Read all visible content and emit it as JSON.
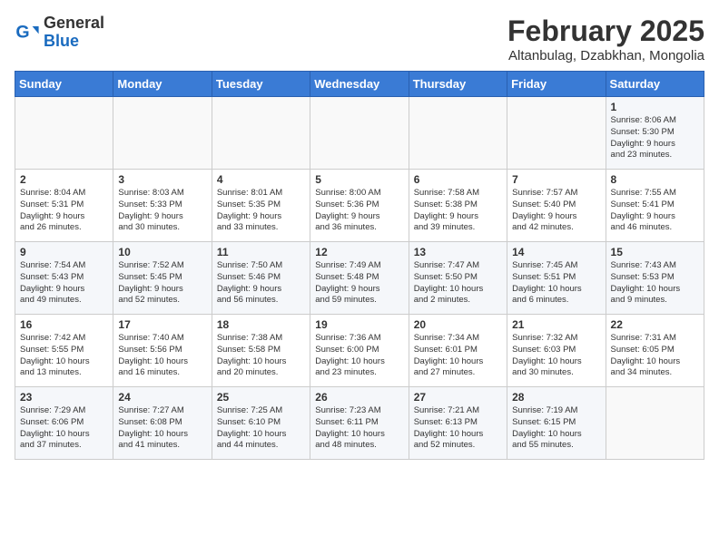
{
  "logo": {
    "general": "General",
    "blue": "Blue"
  },
  "header": {
    "month": "February 2025",
    "location": "Altanbulag, Dzabkhan, Mongolia"
  },
  "weekdays": [
    "Sunday",
    "Monday",
    "Tuesday",
    "Wednesday",
    "Thursday",
    "Friday",
    "Saturday"
  ],
  "weeks": [
    [
      {
        "day": "",
        "info": ""
      },
      {
        "day": "",
        "info": ""
      },
      {
        "day": "",
        "info": ""
      },
      {
        "day": "",
        "info": ""
      },
      {
        "day": "",
        "info": ""
      },
      {
        "day": "",
        "info": ""
      },
      {
        "day": "1",
        "info": "Sunrise: 8:06 AM\nSunset: 5:30 PM\nDaylight: 9 hours\nand 23 minutes."
      }
    ],
    [
      {
        "day": "2",
        "info": "Sunrise: 8:04 AM\nSunset: 5:31 PM\nDaylight: 9 hours\nand 26 minutes."
      },
      {
        "day": "3",
        "info": "Sunrise: 8:03 AM\nSunset: 5:33 PM\nDaylight: 9 hours\nand 30 minutes."
      },
      {
        "day": "4",
        "info": "Sunrise: 8:01 AM\nSunset: 5:35 PM\nDaylight: 9 hours\nand 33 minutes."
      },
      {
        "day": "5",
        "info": "Sunrise: 8:00 AM\nSunset: 5:36 PM\nDaylight: 9 hours\nand 36 minutes."
      },
      {
        "day": "6",
        "info": "Sunrise: 7:58 AM\nSunset: 5:38 PM\nDaylight: 9 hours\nand 39 minutes."
      },
      {
        "day": "7",
        "info": "Sunrise: 7:57 AM\nSunset: 5:40 PM\nDaylight: 9 hours\nand 42 minutes."
      },
      {
        "day": "8",
        "info": "Sunrise: 7:55 AM\nSunset: 5:41 PM\nDaylight: 9 hours\nand 46 minutes."
      }
    ],
    [
      {
        "day": "9",
        "info": "Sunrise: 7:54 AM\nSunset: 5:43 PM\nDaylight: 9 hours\nand 49 minutes."
      },
      {
        "day": "10",
        "info": "Sunrise: 7:52 AM\nSunset: 5:45 PM\nDaylight: 9 hours\nand 52 minutes."
      },
      {
        "day": "11",
        "info": "Sunrise: 7:50 AM\nSunset: 5:46 PM\nDaylight: 9 hours\nand 56 minutes."
      },
      {
        "day": "12",
        "info": "Sunrise: 7:49 AM\nSunset: 5:48 PM\nDaylight: 9 hours\nand 59 minutes."
      },
      {
        "day": "13",
        "info": "Sunrise: 7:47 AM\nSunset: 5:50 PM\nDaylight: 10 hours\nand 2 minutes."
      },
      {
        "day": "14",
        "info": "Sunrise: 7:45 AM\nSunset: 5:51 PM\nDaylight: 10 hours\nand 6 minutes."
      },
      {
        "day": "15",
        "info": "Sunrise: 7:43 AM\nSunset: 5:53 PM\nDaylight: 10 hours\nand 9 minutes."
      }
    ],
    [
      {
        "day": "16",
        "info": "Sunrise: 7:42 AM\nSunset: 5:55 PM\nDaylight: 10 hours\nand 13 minutes."
      },
      {
        "day": "17",
        "info": "Sunrise: 7:40 AM\nSunset: 5:56 PM\nDaylight: 10 hours\nand 16 minutes."
      },
      {
        "day": "18",
        "info": "Sunrise: 7:38 AM\nSunset: 5:58 PM\nDaylight: 10 hours\nand 20 minutes."
      },
      {
        "day": "19",
        "info": "Sunrise: 7:36 AM\nSunset: 6:00 PM\nDaylight: 10 hours\nand 23 minutes."
      },
      {
        "day": "20",
        "info": "Sunrise: 7:34 AM\nSunset: 6:01 PM\nDaylight: 10 hours\nand 27 minutes."
      },
      {
        "day": "21",
        "info": "Sunrise: 7:32 AM\nSunset: 6:03 PM\nDaylight: 10 hours\nand 30 minutes."
      },
      {
        "day": "22",
        "info": "Sunrise: 7:31 AM\nSunset: 6:05 PM\nDaylight: 10 hours\nand 34 minutes."
      }
    ],
    [
      {
        "day": "23",
        "info": "Sunrise: 7:29 AM\nSunset: 6:06 PM\nDaylight: 10 hours\nand 37 minutes."
      },
      {
        "day": "24",
        "info": "Sunrise: 7:27 AM\nSunset: 6:08 PM\nDaylight: 10 hours\nand 41 minutes."
      },
      {
        "day": "25",
        "info": "Sunrise: 7:25 AM\nSunset: 6:10 PM\nDaylight: 10 hours\nand 44 minutes."
      },
      {
        "day": "26",
        "info": "Sunrise: 7:23 AM\nSunset: 6:11 PM\nDaylight: 10 hours\nand 48 minutes."
      },
      {
        "day": "27",
        "info": "Sunrise: 7:21 AM\nSunset: 6:13 PM\nDaylight: 10 hours\nand 52 minutes."
      },
      {
        "day": "28",
        "info": "Sunrise: 7:19 AM\nSunset: 6:15 PM\nDaylight: 10 hours\nand 55 minutes."
      },
      {
        "day": "",
        "info": ""
      }
    ]
  ]
}
